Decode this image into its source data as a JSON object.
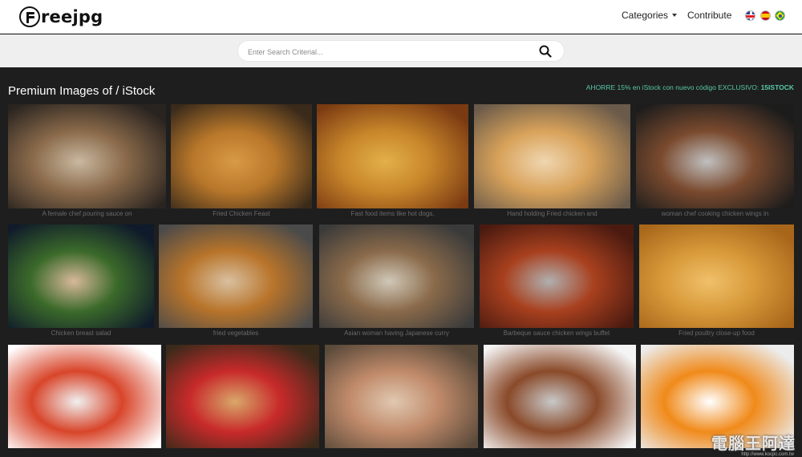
{
  "header": {
    "logo_text": "reejpg",
    "nav_categories": "Categories",
    "nav_contribute": "Contribute",
    "languages": [
      "English",
      "Español",
      "Português"
    ]
  },
  "search": {
    "placeholder": "Enter Search Criterial...",
    "value": ""
  },
  "section": {
    "title": "Premium Images of / iStock",
    "promo_text": "AHORRE 15% en iStock con nuevo código EXCLUSIVO: ",
    "promo_code": "15ISTOCK"
  },
  "rows": [
    {
      "images": [
        {
          "caption": "A female chef pouring sauce on",
          "colors": [
            "#2a2420",
            "#8a6a4a",
            "#c9b8a0"
          ]
        },
        {
          "caption": "Fried Chicken Feast",
          "colors": [
            "#3a2a1a",
            "#b8772a",
            "#d99a45"
          ]
        },
        {
          "caption": "Fast food items like hot dogs,",
          "colors": [
            "#7a3a12",
            "#c8862a",
            "#e3b04a"
          ]
        },
        {
          "caption": "Hand holding Fried chicken and",
          "colors": [
            "#6a5a4a",
            "#d8a25a",
            "#f0d6b0"
          ]
        },
        {
          "caption": "woman chef cooking chicken wings in",
          "colors": [
            "#1c1c1c",
            "#7a4a2e",
            "#c0c0c0"
          ]
        }
      ]
    },
    {
      "images": [
        {
          "caption": "Chicken breast salad",
          "colors": [
            "#0f1a2a",
            "#3b6a2a",
            "#d8b89a"
          ]
        },
        {
          "caption": "fried vegetables",
          "colors": [
            "#4a4a4a",
            "#b8742a",
            "#d9c0a0"
          ]
        },
        {
          "caption": "Asian woman having Japanese curry",
          "colors": [
            "#3a3a3a",
            "#8a6a4a",
            "#d0c8b8"
          ]
        },
        {
          "caption": "Barbeque sauce chicken wings buffet",
          "colors": [
            "#4a1a10",
            "#a8401e",
            "#b0b0b0"
          ]
        },
        {
          "caption": "Fried poultry close-up food",
          "colors": [
            "#a8661a",
            "#d89a3a",
            "#f0c06a"
          ]
        }
      ]
    },
    {
      "images": [
        {
          "caption": "",
          "colors": [
            "#ffffff",
            "#d8452a",
            "#f0f0f0"
          ]
        },
        {
          "caption": "",
          "colors": [
            "#3a2a1a",
            "#c82a2a",
            "#d8a86a"
          ]
        },
        {
          "caption": "",
          "colors": [
            "#5a4a3a",
            "#c08a6a",
            "#e0c8b0"
          ]
        },
        {
          "caption": "",
          "colors": [
            "#f4f4f4",
            "#8a4a2a",
            "#c8c8c8"
          ]
        },
        {
          "caption": "",
          "colors": [
            "#ececec",
            "#f08a1a",
            "#ffffff"
          ]
        }
      ]
    }
  ],
  "watermark": {
    "text": "電腦王阿達",
    "url": "http://www.kocpc.com.tw"
  }
}
